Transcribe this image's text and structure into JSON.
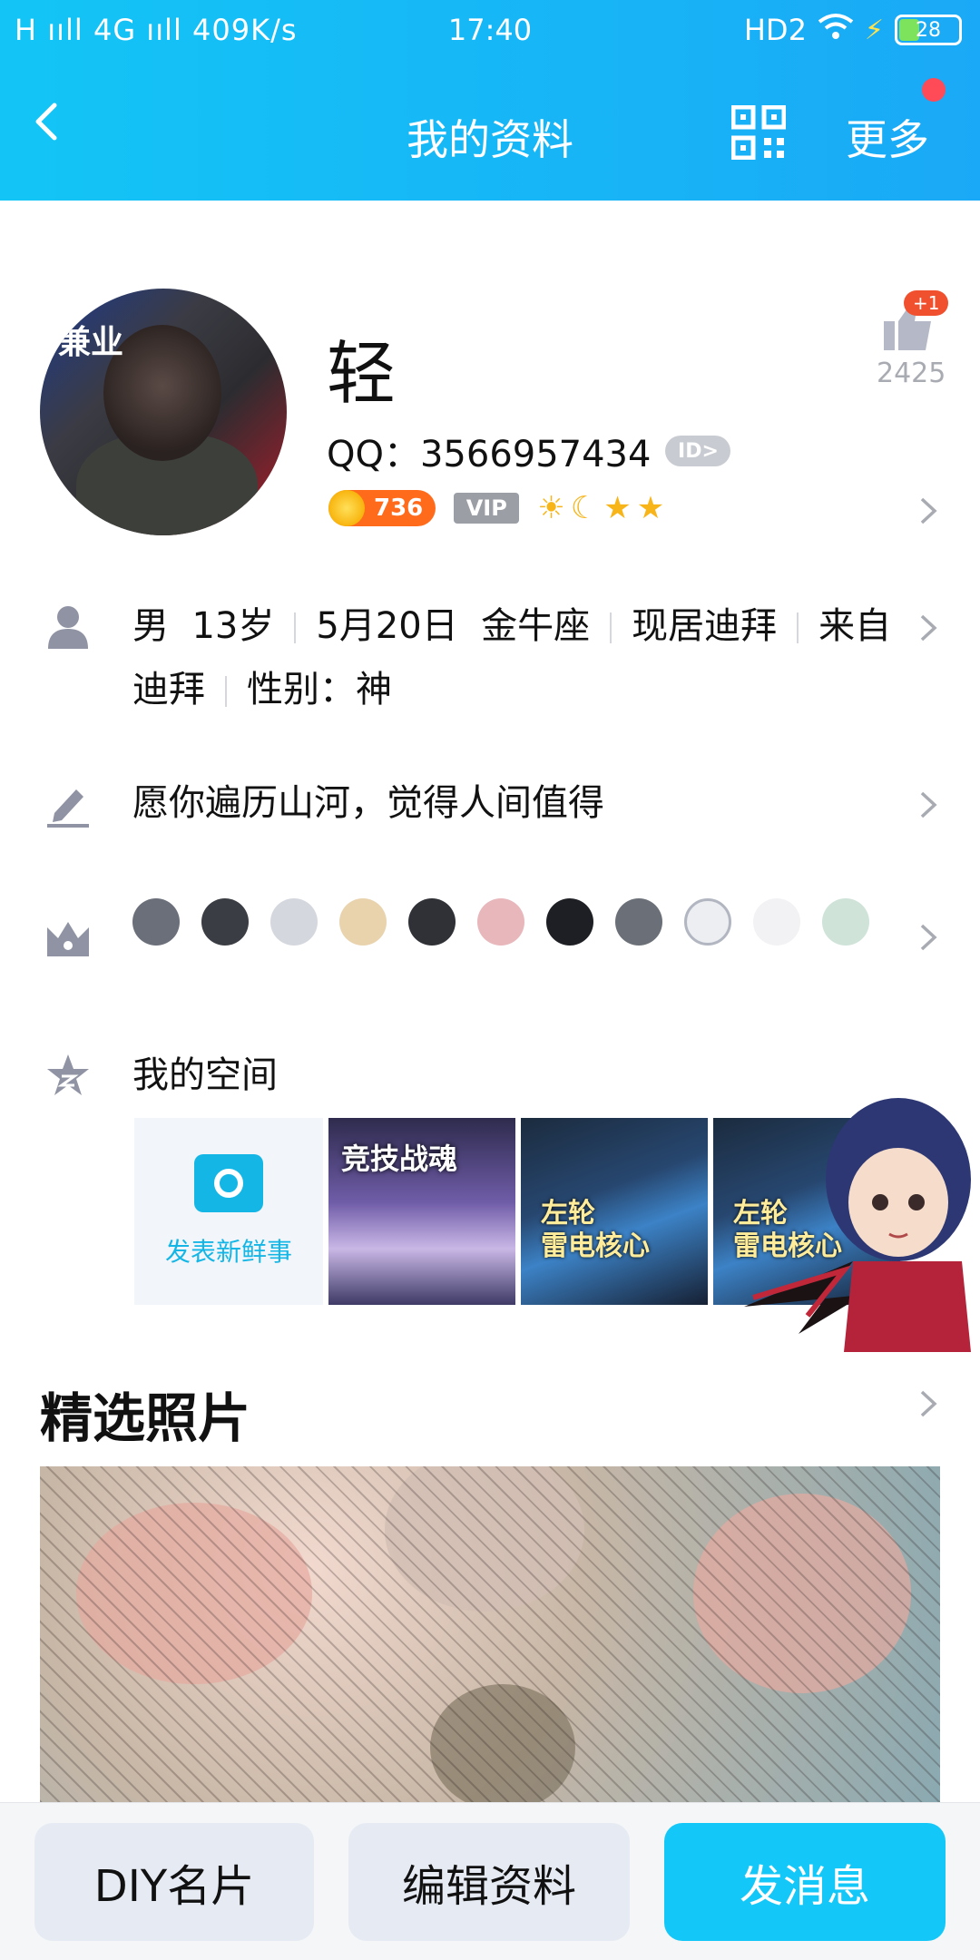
{
  "status_bar": {
    "network": "H ııll 4G ııll 409K/s",
    "time": "17:40",
    "hd": "HD2",
    "battery": "28"
  },
  "header": {
    "title": "我的资料",
    "more": "更多"
  },
  "profile": {
    "name": "轻",
    "qq": "QQ：3566957434",
    "id_badge": "ID>",
    "coins": "736",
    "vip": "VIP",
    "like_plus": "+1",
    "like_count": "2425",
    "avatar_sign": "兼业"
  },
  "info": {
    "gender": "男",
    "age": "13岁",
    "birthday": "5月20日",
    "zodiac": "金牛座",
    "residence": "现居迪拜",
    "from_prefix": "来自",
    "from_city": "迪拜",
    "gender_custom": "性别：神"
  },
  "signature": "愿你遍历山河，觉得人间值得",
  "space": {
    "title": "我的空间",
    "post_new": "发表新鲜事",
    "thumb1_caption": "竞技战魂",
    "thumb2_caption": "左轮\n雷电核心",
    "thumb3_caption": "左轮\n雷电核心"
  },
  "photos": {
    "title": "精选照片"
  },
  "bottom": {
    "diy": "DIY名片",
    "edit": "编辑资料",
    "message": "发消息"
  },
  "colors": {
    "header_start": "#13c5f6",
    "header_end": "#1aa9f6",
    "accent": "#13c8f8",
    "coin": "#ff6b1b"
  }
}
